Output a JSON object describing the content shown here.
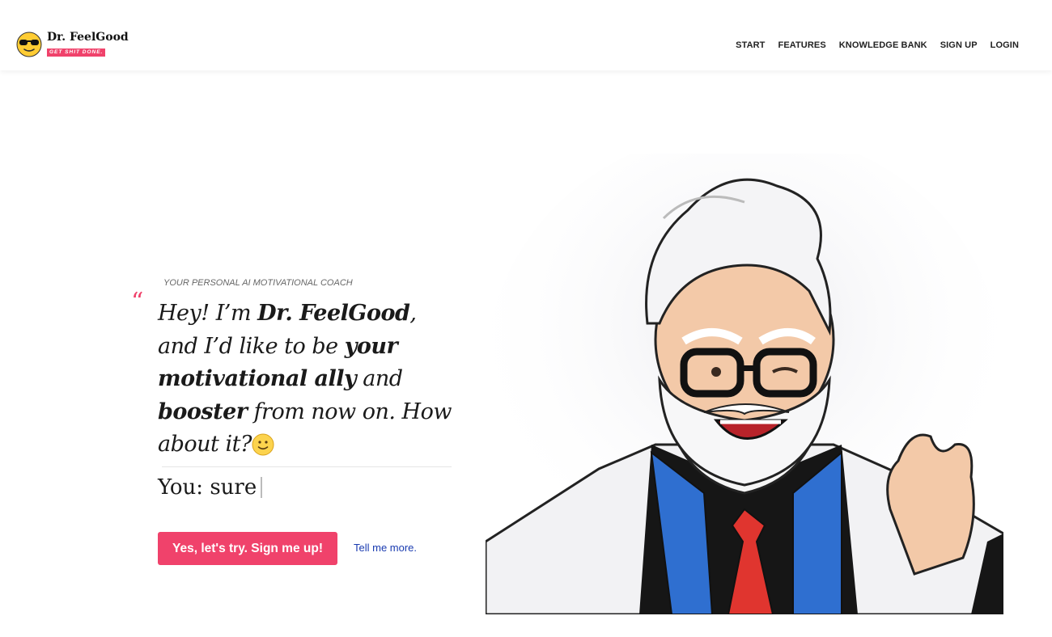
{
  "brand": {
    "name": "Dr. FeelGood",
    "tagline": "GET SHIT DONE.",
    "logo_icon": "sunglasses-emoji-icon"
  },
  "nav": {
    "items": [
      {
        "label": "START"
      },
      {
        "label": "FEATURES"
      },
      {
        "label": "KNOWLEDGE BANK"
      },
      {
        "label": "SIGN UP"
      },
      {
        "label": "LOGIN"
      }
    ]
  },
  "hero": {
    "eyebrow": "YOUR PERSONAL AI MOTIVATIONAL COACH",
    "quote_mark": "“",
    "headline": {
      "p1": "Hey! I’m ",
      "b1": "Dr. FeelGood",
      "p2": ", and I’d like to be ",
      "b2": "your motivational ally",
      "p3": " and ",
      "b3": "booster",
      "p4": " from now on. How about it?"
    },
    "emoji_icon": "slightly-smiling-face-icon",
    "chat": {
      "prefix": "You: ",
      "value": "sure"
    },
    "cta_label": "Yes, let's try. Sign me up!",
    "secondary_link": "Tell me more.",
    "illustration": "doctor-character-illustration"
  },
  "colors": {
    "accent": "#f0426b",
    "link": "#1a3bb0",
    "text": "#1a1a1a"
  }
}
